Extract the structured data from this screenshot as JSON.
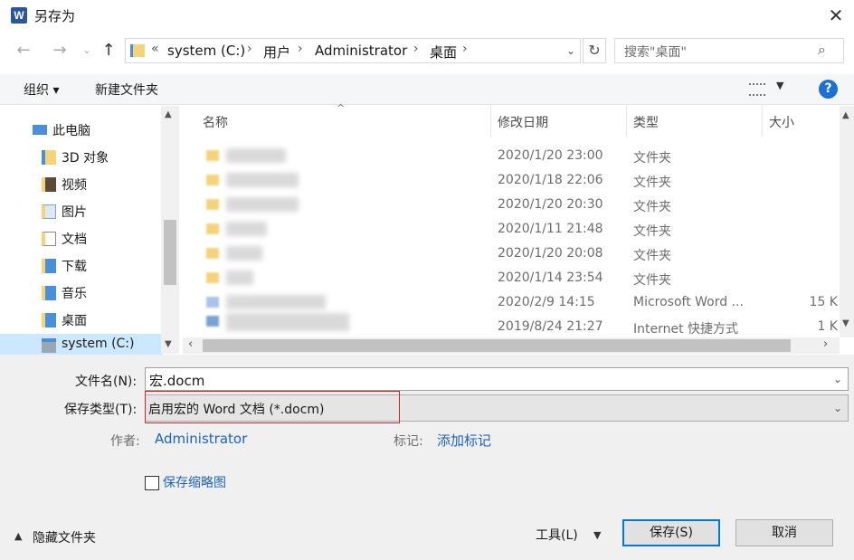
{
  "window": {
    "title": "另存为",
    "app_icon": "W",
    "close_glyph": "✕"
  },
  "nav": {
    "breadcrumb": [
      "system (C:)",
      "用户",
      "Administrator",
      "桌面"
    ],
    "overflow": "«",
    "search_placeholder": "搜索\"桌面\""
  },
  "toolbar": {
    "organize": "组织 ▾",
    "new_folder": "新建文件夹",
    "help": "?"
  },
  "tree": [
    {
      "label": "此电脑",
      "icon": "computer-icon"
    },
    {
      "label": "3D 对象",
      "icon": "3d-objects-icon"
    },
    {
      "label": "视频",
      "icon": "video-icon"
    },
    {
      "label": "图片",
      "icon": "pictures-icon"
    },
    {
      "label": "文档",
      "icon": "documents-icon"
    },
    {
      "label": "下载",
      "icon": "downloads-icon"
    },
    {
      "label": "音乐",
      "icon": "music-icon"
    },
    {
      "label": "桌面",
      "icon": "desktop-icon"
    },
    {
      "label": "system (C:)",
      "icon": "drive-icon"
    }
  ],
  "columns": {
    "name": "名称",
    "date": "修改日期",
    "type": "类型",
    "size": "大小"
  },
  "rows": [
    {
      "date": "2020/1/20 23:00",
      "type": "文件夹",
      "size": ""
    },
    {
      "date": "2020/1/18 22:06",
      "type": "文件夹",
      "size": ""
    },
    {
      "date": "2020/1/20 20:30",
      "type": "文件夹",
      "size": ""
    },
    {
      "date": "2020/1/11 21:48",
      "type": "文件夹",
      "size": ""
    },
    {
      "date": "2020/1/20 20:08",
      "type": "文件夹",
      "size": ""
    },
    {
      "date": "2020/1/14 23:54",
      "type": "文件夹",
      "size": ""
    },
    {
      "date": "2020/2/9 14:15",
      "type": "Microsoft Word ...",
      "size": "15 K"
    },
    {
      "date": "2019/8/24 21:27",
      "type": "Internet 快捷方式",
      "size": "1 K"
    }
  ],
  "form": {
    "filename_label": "文件名(N):",
    "filename_value": "宏.docm",
    "filetype_label": "保存类型(T):",
    "filetype_value": "启用宏的 Word 文档 (*.docm)",
    "author_label": "作者:",
    "author_value": "Administrator",
    "tags_label": "标记:",
    "tags_value": "添加标记",
    "thumbnail_label": "保存缩略图"
  },
  "footer": {
    "hide_folders": "隐藏文件夹",
    "tools": "工具(L)",
    "save": "保存(S)",
    "cancel": "取消"
  }
}
